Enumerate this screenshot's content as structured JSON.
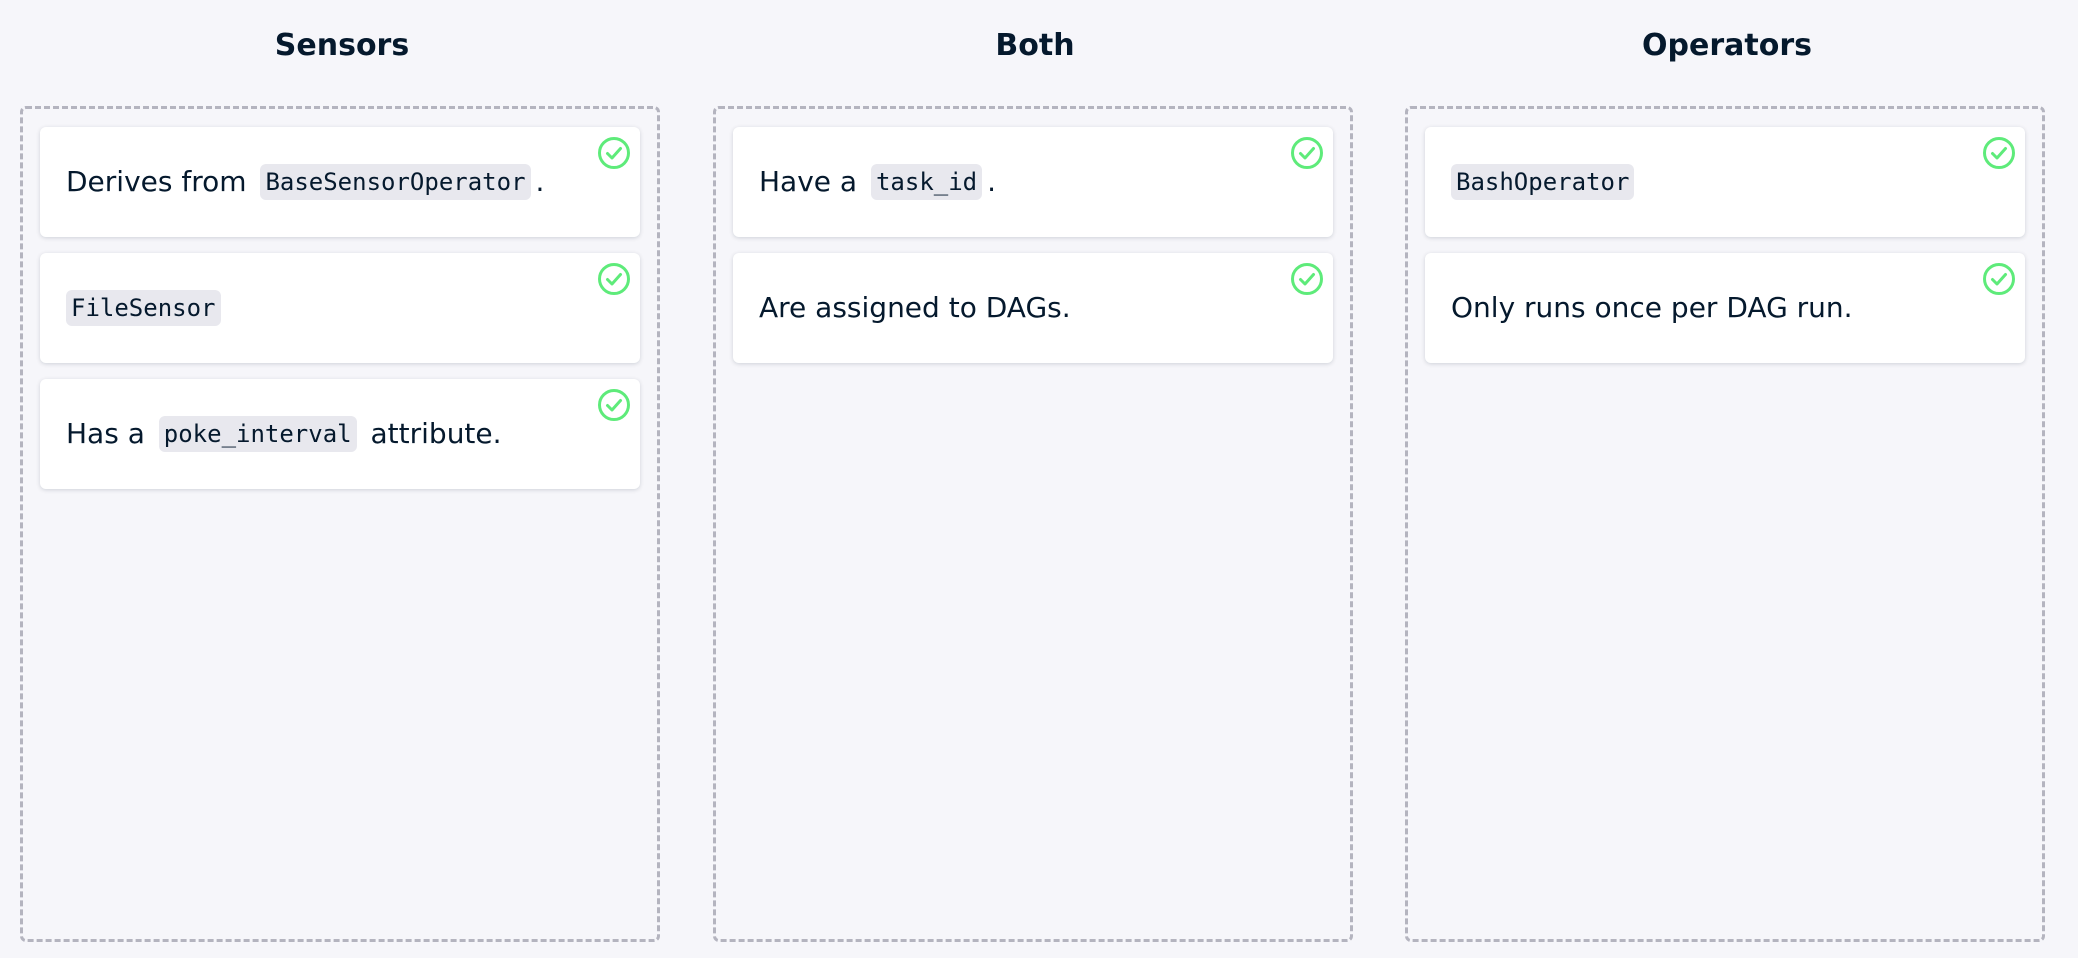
{
  "columns": [
    {
      "title": "Sensors",
      "cards": [
        {
          "parts": [
            {
              "type": "text",
              "value": "Derives from "
            },
            {
              "type": "code",
              "value": "BaseSensorOperator"
            },
            {
              "type": "text",
              "value": "."
            }
          ],
          "status": "correct"
        },
        {
          "parts": [
            {
              "type": "code",
              "value": "FileSensor"
            }
          ],
          "status": "correct"
        },
        {
          "parts": [
            {
              "type": "text",
              "value": "Has a "
            },
            {
              "type": "code",
              "value": "poke_interval"
            },
            {
              "type": "text",
              "value": " attribute."
            }
          ],
          "status": "correct"
        }
      ]
    },
    {
      "title": "Both",
      "cards": [
        {
          "parts": [
            {
              "type": "text",
              "value": "Have a "
            },
            {
              "type": "code",
              "value": "task_id"
            },
            {
              "type": "text",
              "value": "."
            }
          ],
          "status": "correct"
        },
        {
          "parts": [
            {
              "type": "text",
              "value": "Are assigned to DAGs."
            }
          ],
          "status": "correct"
        }
      ]
    },
    {
      "title": "Operators",
      "cards": [
        {
          "parts": [
            {
              "type": "code",
              "value": "BashOperator"
            }
          ],
          "status": "correct"
        },
        {
          "parts": [
            {
              "type": "text",
              "value": "Only runs once per DAG run."
            }
          ],
          "status": "correct"
        }
      ]
    }
  ],
  "icons": {
    "status_icon": "check-circle-icon"
  },
  "colors": {
    "correct": "#5eeb7a",
    "background": "#f6f6fa",
    "dropzone_border": "#b4b4bf",
    "code_background": "#e8e8ee",
    "text": "#05192d"
  }
}
